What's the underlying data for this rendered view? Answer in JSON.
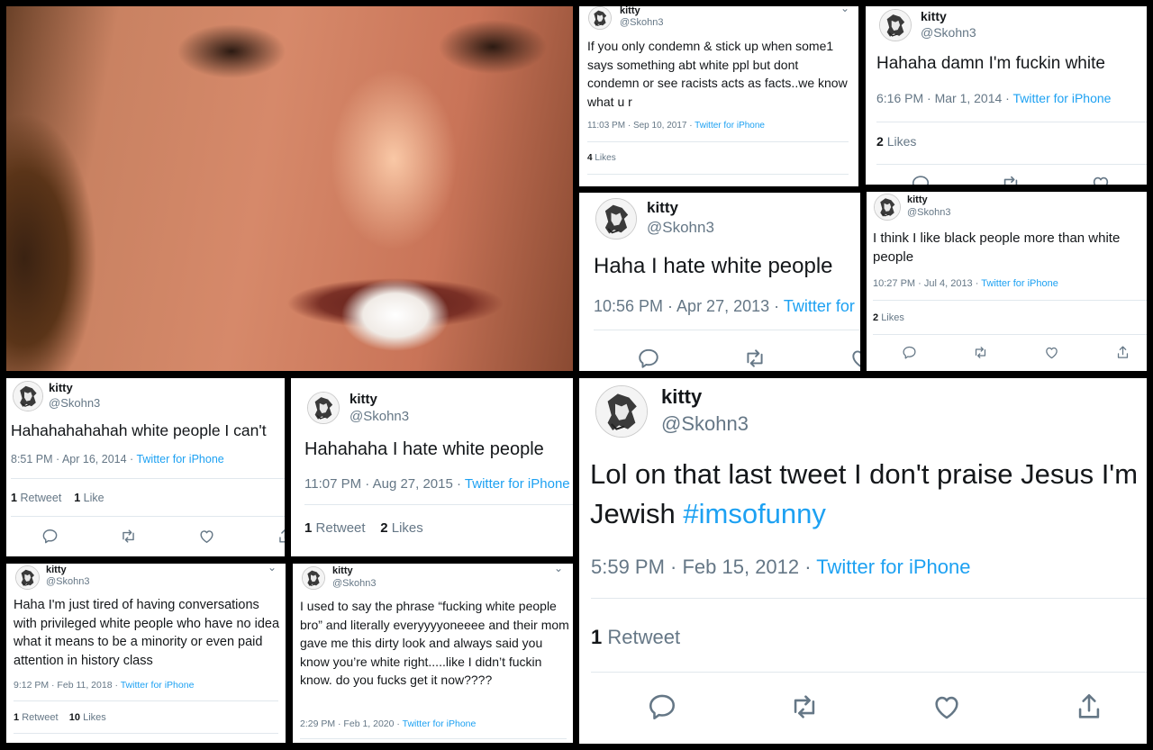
{
  "user": {
    "name": "kitty",
    "handle": "@Skohn3"
  },
  "source": "Twitter for iPhone",
  "icons": {
    "reply": "reply-icon",
    "retweet": "retweet-icon",
    "like": "heart-icon",
    "share": "share-icon",
    "more": "chevron-down-icon"
  },
  "tweets": {
    "t1": {
      "text": "If you only condemn & stick up when some1 says something abt white ppl but dont condemn or see racists acts as facts..we know what u r",
      "time": "11:03 PM · Sep 10, 2017",
      "likes_count": "4",
      "likes_label": "Likes"
    },
    "t2": {
      "text": "Hahaha damn I'm fuckin white",
      "time": "6:16 PM · Mar 1, 2014",
      "likes_count": "2",
      "likes_label": "Likes"
    },
    "t3": {
      "text": "Haha I hate white people",
      "time": "10:56 PM · Apr 27, 2013",
      "source": "Twitter for"
    },
    "t4": {
      "text": "I think I like black people more than white people",
      "time": "10:27 PM · Jul 4, 2013",
      "likes_count": "2",
      "likes_label": "Likes"
    },
    "t5": {
      "text": "Hahahahahahah white people I can't",
      "time": "8:51 PM · Apr 16, 2014",
      "retweets_count": "1",
      "retweets_label": "Retweet",
      "likes_count": "1",
      "likes_label": "Like"
    },
    "t6": {
      "text": "Hahahaha I hate white people",
      "time": "11:07 PM · Aug 27, 2015",
      "retweets_count": "1",
      "retweets_label": "Retweet",
      "likes_count": "2",
      "likes_label": "Likes"
    },
    "t7": {
      "text_main": "Lol on that last tweet I don't praise Jesus I'm Jewish ",
      "hashtag": "#imsofunny",
      "time": "5:59 PM · Feb 15, 2012",
      "retweets_count": "1",
      "retweets_label": "Retweet"
    },
    "t8": {
      "text": "Haha I'm just tired of having conversations with privileged white people who have no idea what it means to be a minority or even paid attention in history class",
      "time": "9:12 PM · Feb 11, 2018",
      "retweets_count": "1",
      "retweets_label": "Retweet",
      "likes_count": "10",
      "likes_label": "Likes"
    },
    "t9": {
      "text": "I used to say the phrase “fucking white people bro” and literally everyyyyoneeee and their mom gave me this dirty look and always said you know you’re white right.....like I didn’t fuckin know. do you fucks get it now????",
      "time": "2:29 PM · Feb 1, 2020"
    }
  }
}
